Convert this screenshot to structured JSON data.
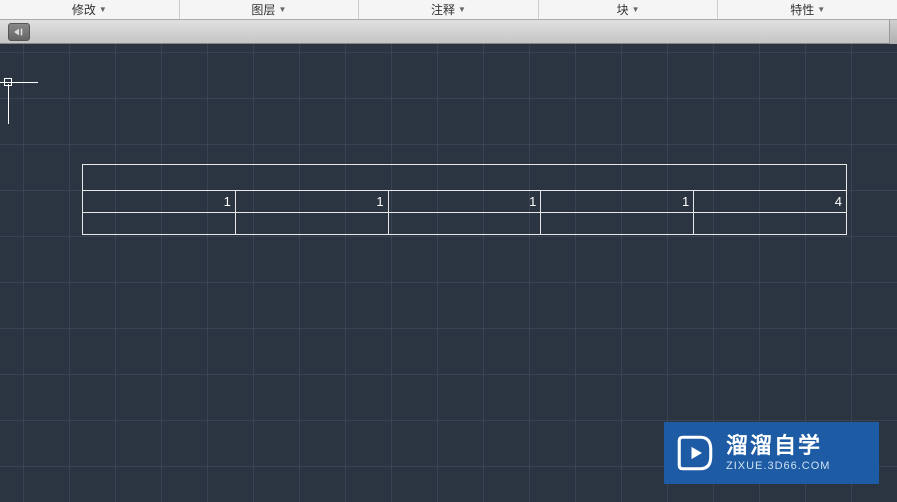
{
  "menu": {
    "items": [
      {
        "label": "修改"
      },
      {
        "label": "图层"
      },
      {
        "label": "注释"
      },
      {
        "label": "块"
      },
      {
        "label": "特性"
      }
    ],
    "expand_glyph": "▼"
  },
  "table": {
    "rows": [
      {
        "type": "title",
        "cells": [
          ""
        ]
      },
      {
        "type": "data",
        "cells": [
          "1",
          "1",
          "1",
          "1",
          "4"
        ]
      },
      {
        "type": "data",
        "cells": [
          "",
          "",
          "",
          "",
          ""
        ]
      }
    ]
  },
  "watermark": {
    "title": "溜溜自学",
    "subtitle": "ZIXUE.3D66.COM"
  }
}
